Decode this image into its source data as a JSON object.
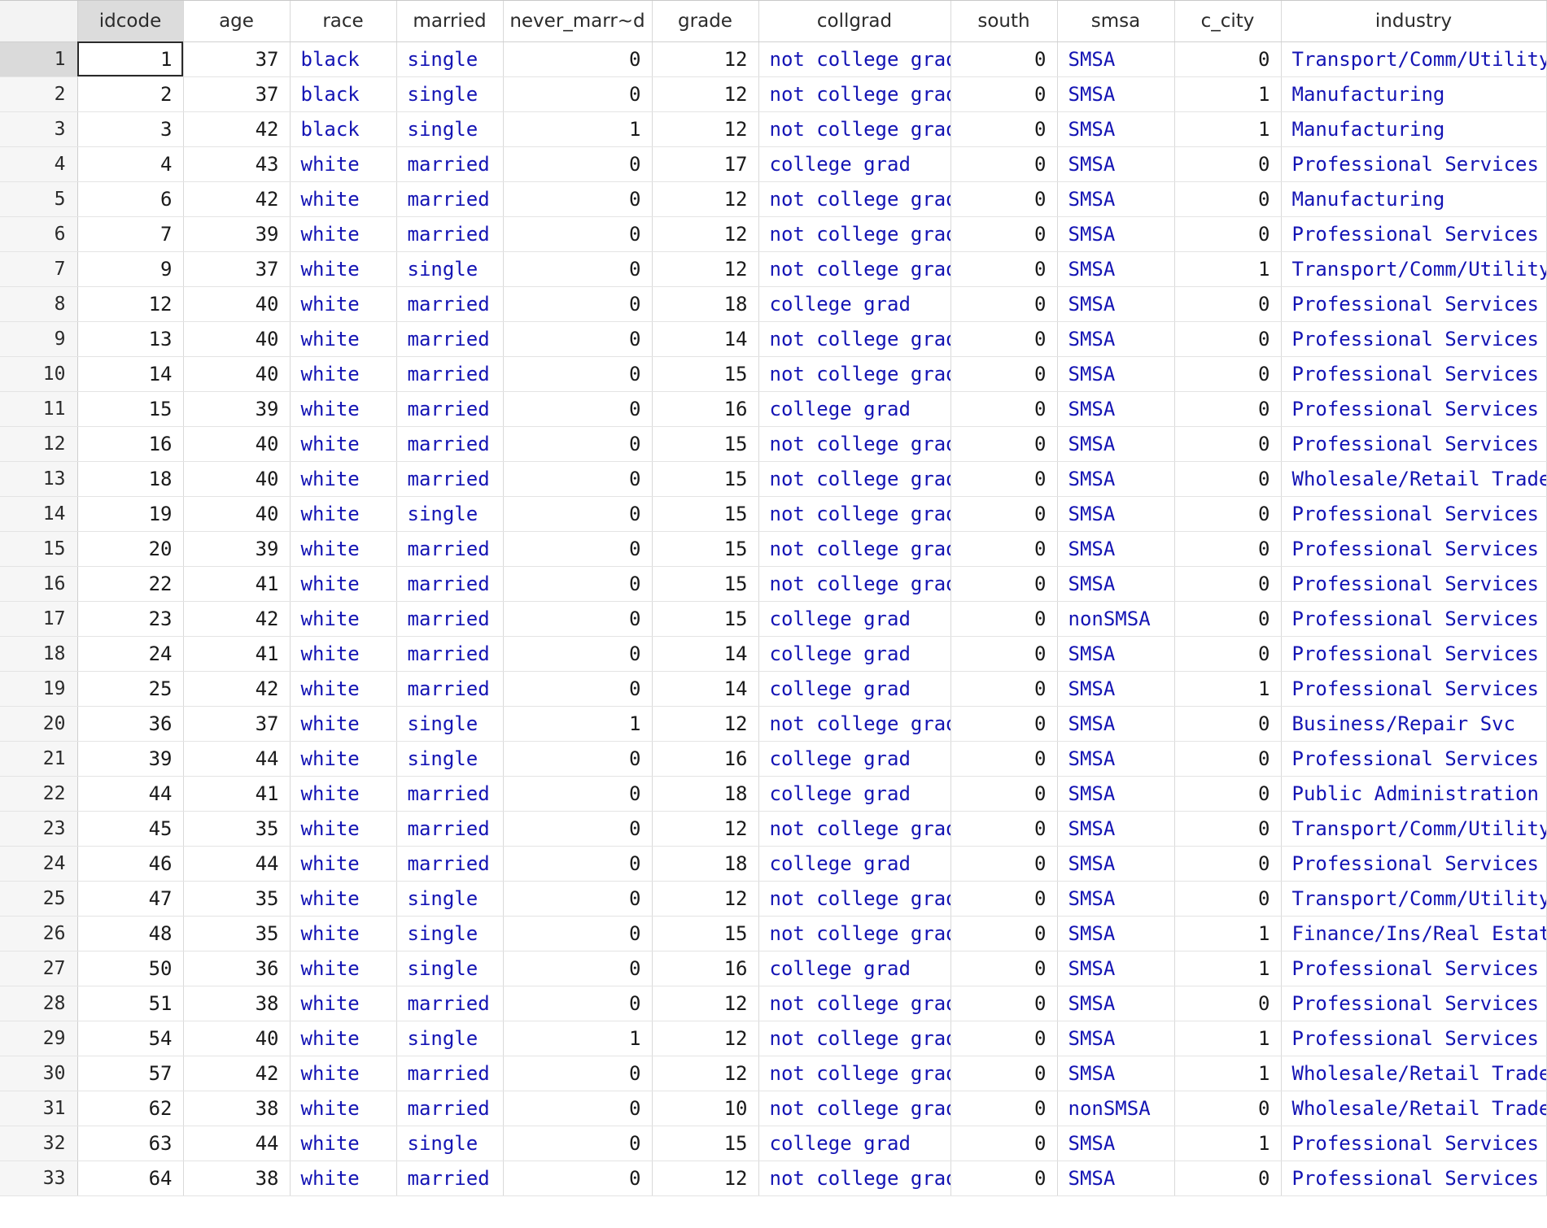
{
  "columns": [
    "idcode",
    "age",
    "race",
    "married",
    "never_marr~d",
    "grade",
    "collgrad",
    "south",
    "smsa",
    "c_city",
    "industry"
  ],
  "rows": [
    {
      "n": "1",
      "cells": [
        "1",
        "37",
        "black",
        "single",
        "0",
        "12",
        "not college grad",
        "0",
        "SMSA",
        "0",
        "Transport/Comm/Utility"
      ]
    },
    {
      "n": "2",
      "cells": [
        "2",
        "37",
        "black",
        "single",
        "0",
        "12",
        "not college grad",
        "0",
        "SMSA",
        "1",
        "Manufacturing"
      ]
    },
    {
      "n": "3",
      "cells": [
        "3",
        "42",
        "black",
        "single",
        "1",
        "12",
        "not college grad",
        "0",
        "SMSA",
        "1",
        "Manufacturing"
      ]
    },
    {
      "n": "4",
      "cells": [
        "4",
        "43",
        "white",
        "married",
        "0",
        "17",
        "college grad",
        "0",
        "SMSA",
        "0",
        "Professional Services"
      ]
    },
    {
      "n": "5",
      "cells": [
        "6",
        "42",
        "white",
        "married",
        "0",
        "12",
        "not college grad",
        "0",
        "SMSA",
        "0",
        "Manufacturing"
      ]
    },
    {
      "n": "6",
      "cells": [
        "7",
        "39",
        "white",
        "married",
        "0",
        "12",
        "not college grad",
        "0",
        "SMSA",
        "0",
        "Professional Services"
      ]
    },
    {
      "n": "7",
      "cells": [
        "9",
        "37",
        "white",
        "single",
        "0",
        "12",
        "not college grad",
        "0",
        "SMSA",
        "1",
        "Transport/Comm/Utility"
      ]
    },
    {
      "n": "8",
      "cells": [
        "12",
        "40",
        "white",
        "married",
        "0",
        "18",
        "college grad",
        "0",
        "SMSA",
        "0",
        "Professional Services"
      ]
    },
    {
      "n": "9",
      "cells": [
        "13",
        "40",
        "white",
        "married",
        "0",
        "14",
        "not college grad",
        "0",
        "SMSA",
        "0",
        "Professional Services"
      ]
    },
    {
      "n": "10",
      "cells": [
        "14",
        "40",
        "white",
        "married",
        "0",
        "15",
        "not college grad",
        "0",
        "SMSA",
        "0",
        "Professional Services"
      ]
    },
    {
      "n": "11",
      "cells": [
        "15",
        "39",
        "white",
        "married",
        "0",
        "16",
        "college grad",
        "0",
        "SMSA",
        "0",
        "Professional Services"
      ]
    },
    {
      "n": "12",
      "cells": [
        "16",
        "40",
        "white",
        "married",
        "0",
        "15",
        "not college grad",
        "0",
        "SMSA",
        "0",
        "Professional Services"
      ]
    },
    {
      "n": "13",
      "cells": [
        "18",
        "40",
        "white",
        "married",
        "0",
        "15",
        "not college grad",
        "0",
        "SMSA",
        "0",
        "Wholesale/Retail Trade"
      ]
    },
    {
      "n": "14",
      "cells": [
        "19",
        "40",
        "white",
        "single",
        "0",
        "15",
        "not college grad",
        "0",
        "SMSA",
        "0",
        "Professional Services"
      ]
    },
    {
      "n": "15",
      "cells": [
        "20",
        "39",
        "white",
        "married",
        "0",
        "15",
        "not college grad",
        "0",
        "SMSA",
        "0",
        "Professional Services"
      ]
    },
    {
      "n": "16",
      "cells": [
        "22",
        "41",
        "white",
        "married",
        "0",
        "15",
        "not college grad",
        "0",
        "SMSA",
        "0",
        "Professional Services"
      ]
    },
    {
      "n": "17",
      "cells": [
        "23",
        "42",
        "white",
        "married",
        "0",
        "15",
        "college grad",
        "0",
        "nonSMSA",
        "0",
        "Professional Services"
      ]
    },
    {
      "n": "18",
      "cells": [
        "24",
        "41",
        "white",
        "married",
        "0",
        "14",
        "college grad",
        "0",
        "SMSA",
        "0",
        "Professional Services"
      ]
    },
    {
      "n": "19",
      "cells": [
        "25",
        "42",
        "white",
        "married",
        "0",
        "14",
        "college grad",
        "0",
        "SMSA",
        "1",
        "Professional Services"
      ]
    },
    {
      "n": "20",
      "cells": [
        "36",
        "37",
        "white",
        "single",
        "1",
        "12",
        "not college grad",
        "0",
        "SMSA",
        "0",
        "Business/Repair Svc"
      ]
    },
    {
      "n": "21",
      "cells": [
        "39",
        "44",
        "white",
        "single",
        "0",
        "16",
        "college grad",
        "0",
        "SMSA",
        "0",
        "Professional Services"
      ]
    },
    {
      "n": "22",
      "cells": [
        "44",
        "41",
        "white",
        "married",
        "0",
        "18",
        "college grad",
        "0",
        "SMSA",
        "0",
        "Public Administration"
      ]
    },
    {
      "n": "23",
      "cells": [
        "45",
        "35",
        "white",
        "married",
        "0",
        "12",
        "not college grad",
        "0",
        "SMSA",
        "0",
        "Transport/Comm/Utility"
      ]
    },
    {
      "n": "24",
      "cells": [
        "46",
        "44",
        "white",
        "married",
        "0",
        "18",
        "college grad",
        "0",
        "SMSA",
        "0",
        "Professional Services"
      ]
    },
    {
      "n": "25",
      "cells": [
        "47",
        "35",
        "white",
        "single",
        "0",
        "12",
        "not college grad",
        "0",
        "SMSA",
        "0",
        "Transport/Comm/Utility"
      ]
    },
    {
      "n": "26",
      "cells": [
        "48",
        "35",
        "white",
        "single",
        "0",
        "15",
        "not college grad",
        "0",
        "SMSA",
        "1",
        "Finance/Ins/Real Estate"
      ]
    },
    {
      "n": "27",
      "cells": [
        "50",
        "36",
        "white",
        "single",
        "0",
        "16",
        "college grad",
        "0",
        "SMSA",
        "1",
        "Professional Services"
      ]
    },
    {
      "n": "28",
      "cells": [
        "51",
        "38",
        "white",
        "married",
        "0",
        "12",
        "not college grad",
        "0",
        "SMSA",
        "0",
        "Professional Services"
      ]
    },
    {
      "n": "29",
      "cells": [
        "54",
        "40",
        "white",
        "single",
        "1",
        "12",
        "not college grad",
        "0",
        "SMSA",
        "1",
        "Professional Services"
      ]
    },
    {
      "n": "30",
      "cells": [
        "57",
        "42",
        "white",
        "married",
        "0",
        "12",
        "not college grad",
        "0",
        "SMSA",
        "1",
        "Wholesale/Retail Trade"
      ]
    },
    {
      "n": "31",
      "cells": [
        "62",
        "38",
        "white",
        "married",
        "0",
        "10",
        "not college grad",
        "0",
        "nonSMSA",
        "0",
        "Wholesale/Retail Trade"
      ]
    },
    {
      "n": "32",
      "cells": [
        "63",
        "44",
        "white",
        "single",
        "0",
        "15",
        "college grad",
        "0",
        "SMSA",
        "1",
        "Professional Services"
      ]
    },
    {
      "n": "33",
      "cells": [
        "64",
        "38",
        "white",
        "married",
        "0",
        "12",
        "not college grad",
        "0",
        "SMSA",
        "0",
        "Professional Services"
      ]
    }
  ],
  "selection": {
    "row": "1",
    "column": "idcode"
  },
  "colors": {
    "label_text": "#1414b4",
    "number_text": "#1a1a1a",
    "selected_header": "#dcdcdc",
    "row_header_bg": "#f6f6f6"
  }
}
